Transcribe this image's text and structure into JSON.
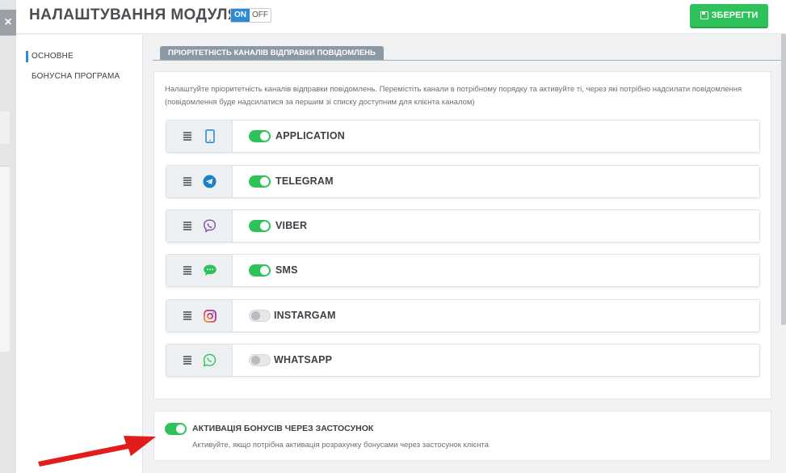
{
  "header": {
    "title": "НАЛАШТУВАННЯ МОДУЛЯ",
    "toggle_on": "ON",
    "toggle_off": "OFF",
    "save_label": "ЗБЕРЕГТИ"
  },
  "backdrop": {
    "close_glyph": "×"
  },
  "sidebar": {
    "items": [
      {
        "label": "ОСНОВНЕ",
        "active": true
      },
      {
        "label": "БОНУСНА ПРОГРАМА",
        "active": false
      }
    ]
  },
  "main": {
    "tab_label": "ПРІОРІТЕТНІСТЬ КАНАЛІВ ВІДПРАВКИ ПОВІДОМЛЕНЬ",
    "description": "Налаштуйте пріоритетність каналів відправки повідомлень. Перемістіть канали в потрібному порядку та активуйте ті, через які потрібно надсилати повідомлення (повідомлення буде надсилатися за першим зі списку доступним для клієнта каналом)",
    "channels": [
      {
        "name": "APPLICATION",
        "icon": "mobile-phone-icon",
        "enabled": true
      },
      {
        "name": "TELEGRAM",
        "icon": "telegram-icon",
        "enabled": true
      },
      {
        "name": "VIBER",
        "icon": "viber-icon",
        "enabled": true
      },
      {
        "name": "SMS",
        "icon": "sms-icon",
        "enabled": true
      },
      {
        "name": "INSTARGAM",
        "icon": "instagram-icon",
        "enabled": false
      },
      {
        "name": "WHATSAPP",
        "icon": "whatsapp-icon",
        "enabled": false
      }
    ],
    "bonus": {
      "title": "АКТИВАЦІЯ БОНУСІВ ЧЕРЕЗ ЗАСТОСУНОК",
      "subtitle": "Активуйте, якщо потрібна активація розрахунку бонусами через застосунок клієнта",
      "enabled": true
    }
  },
  "colors": {
    "accent_blue": "#2d8bd6",
    "save_green": "#2ec35a",
    "toggle_on_green": "#2ec35a",
    "arrow_red": "#e21b1b"
  }
}
